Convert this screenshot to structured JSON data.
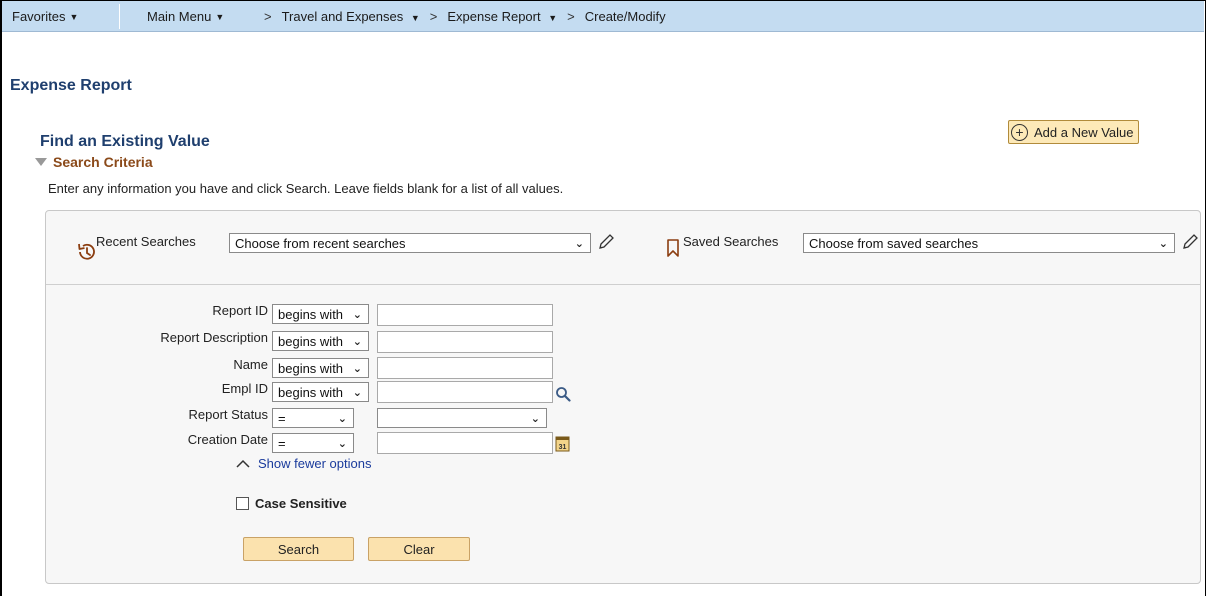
{
  "nav": {
    "favorites": "Favorites",
    "main_menu": "Main Menu",
    "travel": "Travel and Expenses",
    "expense_report": "Expense Report",
    "create_modify": "Create/Modify"
  },
  "page_title": "Expense Report",
  "find_title": "Find an Existing Value",
  "add_new_label": "Add a New Value",
  "search_criteria_label": "Search Criteria",
  "instructions": "Enter any information you have and click Search. Leave fields blank for a list of all values.",
  "recent": {
    "label": "Recent Searches",
    "value": "Choose from recent searches"
  },
  "saved": {
    "label": "Saved Searches",
    "value": "Choose from saved searches"
  },
  "fields": {
    "report_id": {
      "label": "Report ID",
      "op": "begins with",
      "value": ""
    },
    "report_description": {
      "label": "Report Description",
      "op": "begins with",
      "value": ""
    },
    "name": {
      "label": "Name",
      "op": "begins with",
      "value": ""
    },
    "empl_id": {
      "label": "Empl ID",
      "op": "begins with",
      "value": ""
    },
    "report_status": {
      "label": "Report Status",
      "op": "=",
      "value": ""
    },
    "creation_date": {
      "label": "Creation Date",
      "op": "=",
      "value": ""
    }
  },
  "show_fewer_label": "Show fewer options",
  "case_sensitive_label": "Case Sensitive",
  "buttons": {
    "search": "Search",
    "clear": "Clear"
  },
  "colors": {
    "nav_bg": "#c4dcf1",
    "title_blue": "#1f3f6e",
    "button_bg": "#fbe2ae",
    "link_blue": "#1a3b9c"
  }
}
